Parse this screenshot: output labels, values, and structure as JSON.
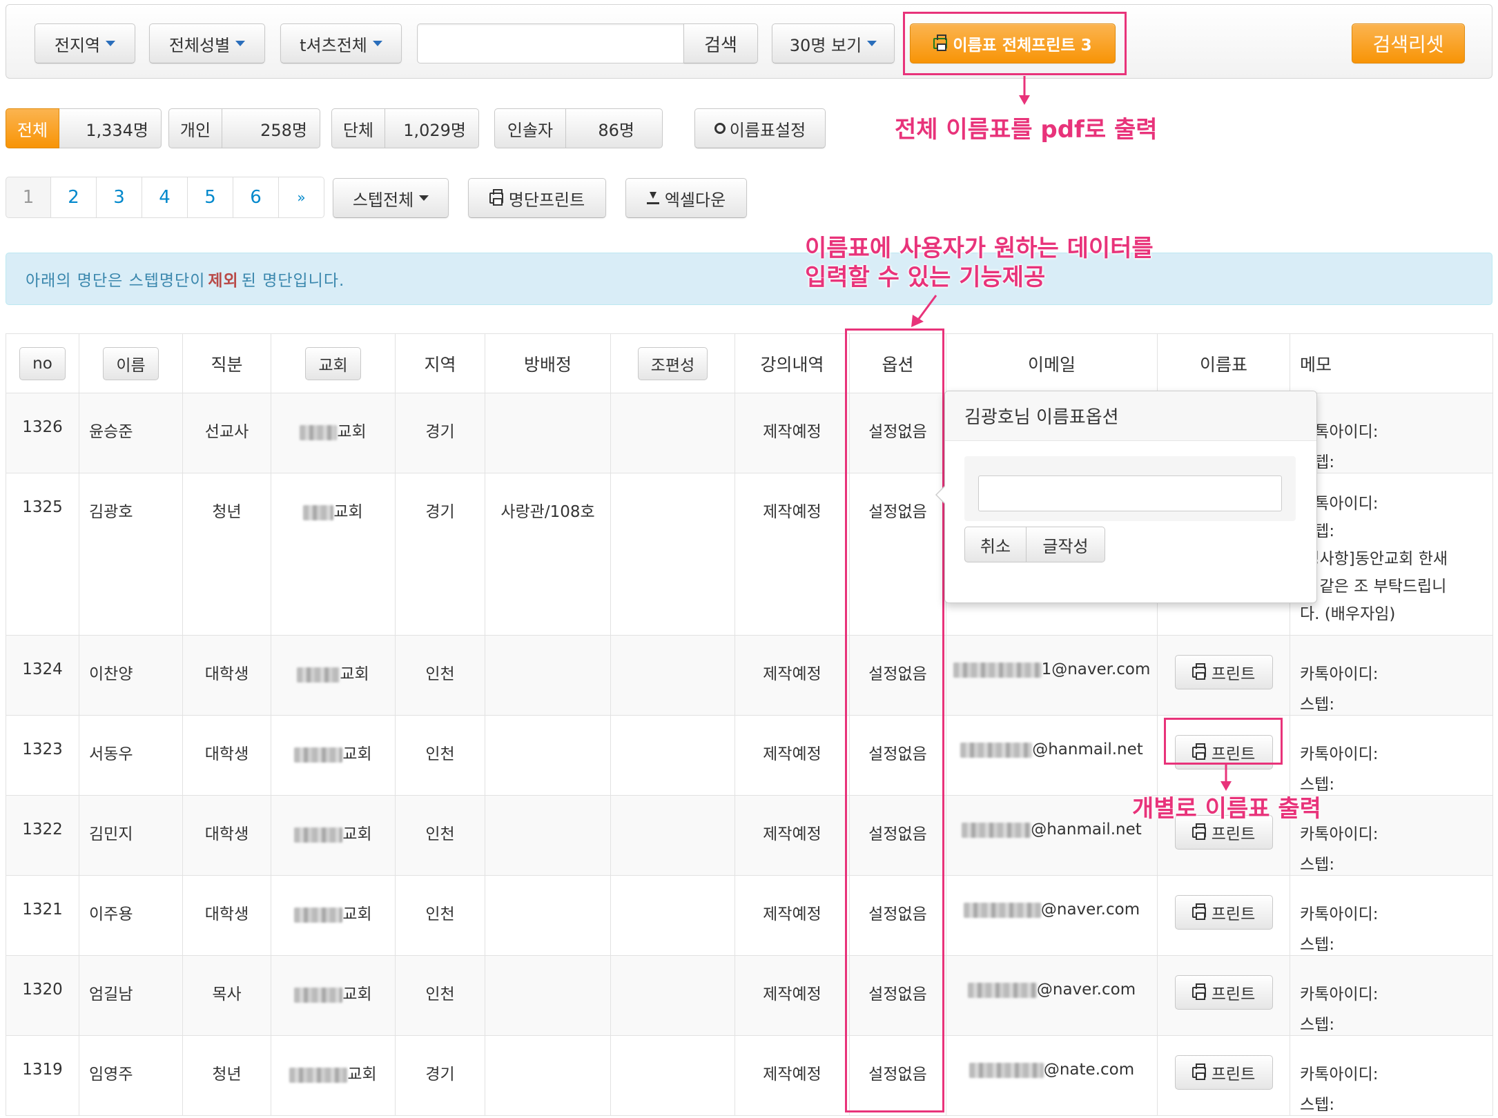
{
  "toolbar": {
    "region_label": "전지역",
    "gender_label": "전체성별",
    "tshirt_label": "t셔츠전체",
    "search_value": "",
    "search_button": "검색",
    "page_size_label": "30명 보기",
    "print_all_label": "이름표 전체프린트 3",
    "reset_label": "검색리셋"
  },
  "stats": [
    {
      "label": "전체",
      "value": "1,334명"
    },
    {
      "label": "개인",
      "value": "258명"
    },
    {
      "label": "단체",
      "value": "1,029명"
    },
    {
      "label": "인솔자",
      "value": "86명"
    }
  ],
  "nametag_settings_label": "이름표설정",
  "pagination": [
    "1",
    "2",
    "3",
    "4",
    "5",
    "6",
    "»"
  ],
  "step_filter_label": "스텝전체",
  "list_print_label": "명단프린트",
  "excel_down_label": "엑셀다운",
  "alert": {
    "part1": "아래의 명단은 스텝명단이 ",
    "strong": "제외",
    "part2": "된 명단입니다."
  },
  "annotations": {
    "pdf": "전체 이름표를 pdf로 출력",
    "option_line1": "이름표에 사용자가 원하는 데이터를",
    "option_line2": "입력할 수 있는 기능제공",
    "individual": "개별로 이름표 출력"
  },
  "table": {
    "headers": [
      "no",
      "이름",
      "직분",
      "교회",
      "지역",
      "방배정",
      "조편성",
      "강의내역",
      "옵션",
      "이메일",
      "이름표",
      "메모"
    ],
    "print_label": "프린트",
    "memo_kakao": "카톡아이디:",
    "memo_step": "스텝:",
    "rows": [
      {
        "no": "1326",
        "name": "윤승준",
        "role": "선교사",
        "church": "교회",
        "region": "경기",
        "room": "",
        "lecture": "제작예정",
        "option": "설정없음",
        "email": ""
      },
      {
        "no": "1325",
        "name": "김광호",
        "role": "청년",
        "church": "교회",
        "region": "경기",
        "room": "사랑관/108호",
        "lecture": "제작예정",
        "option": "설정없음",
        "email": "",
        "memo_extra1": ".청사항]동안교회 한새",
        "memo_extra2": "과 같은 조 부탁드립니",
        "memo_extra3": "다. (배우자임)"
      },
      {
        "no": "1324",
        "name": "이찬양",
        "role": "대학생",
        "church": "교회",
        "region": "인천",
        "room": "",
        "lecture": "제작예정",
        "option": "설정없음",
        "email": "1@naver.com"
      },
      {
        "no": "1323",
        "name": "서동우",
        "role": "대학생",
        "church": "교회",
        "region": "인천",
        "room": "",
        "lecture": "제작예정",
        "option": "설정없음",
        "email": "@hanmail.net"
      },
      {
        "no": "1322",
        "name": "김민지",
        "role": "대학생",
        "church": "교회",
        "region": "인천",
        "room": "",
        "lecture": "제작예정",
        "option": "설정없음",
        "email": "@hanmail.net"
      },
      {
        "no": "1321",
        "name": "이주용",
        "role": "대학생",
        "church": "교회",
        "region": "인천",
        "room": "",
        "lecture": "제작예정",
        "option": "설정없음",
        "email": "@naver.com"
      },
      {
        "no": "1320",
        "name": "엄길남",
        "role": "목사",
        "church": "교회",
        "region": "인천",
        "room": "",
        "lecture": "제작예정",
        "option": "설정없음",
        "email": "@naver.com"
      },
      {
        "no": "1319",
        "name": "임영주",
        "role": "청년",
        "church": "교회",
        "region": "경기",
        "room": "",
        "lecture": "제작예정",
        "option": "설정없음",
        "email": "@nate.com"
      }
    ]
  },
  "popover": {
    "title": "김광호님 이름표옵션",
    "input_value": "",
    "cancel_label": "취소",
    "write_label": "글작성"
  },
  "colors": {
    "orange": "#f89406",
    "annotation": "#e8337a",
    "link": "#0088cc",
    "alert_text": "#3a87ad"
  }
}
